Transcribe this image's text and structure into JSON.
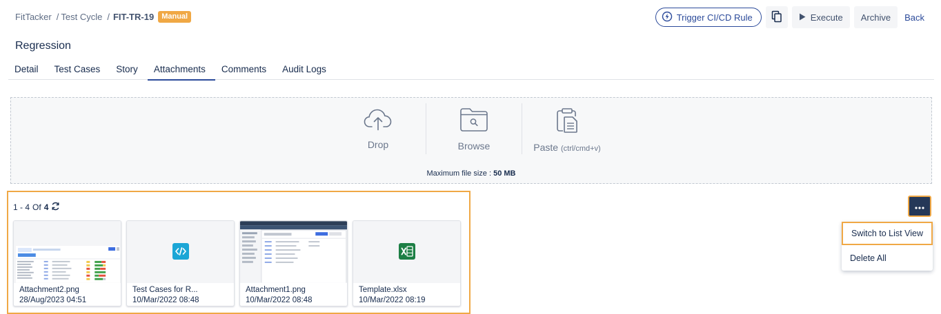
{
  "breadcrumb": {
    "root": "FitTacker",
    "parent": "Test Cycle",
    "sep": "/",
    "current": "FIT-TR-19",
    "badge": "Manual"
  },
  "actions": {
    "trigger": "Trigger CI/CD Rule",
    "execute": "Execute",
    "archive": "Archive",
    "back": "Back"
  },
  "page": {
    "title": "Regression"
  },
  "tabs": [
    "Detail",
    "Test Cases",
    "Story",
    "Attachments",
    "Comments",
    "Audit Logs"
  ],
  "upload": {
    "drop": "Drop",
    "browse": "Browse",
    "paste": "Paste",
    "paste_hint": "(ctrl/cmd+v)",
    "max_label": "Maximum file size :",
    "max_value": "50 MB"
  },
  "pagination": {
    "range": "1 - 4",
    "of": "Of",
    "total": "4"
  },
  "attachments": [
    {
      "name": "Attachment2.png",
      "date": "28/Aug/2023 04:51"
    },
    {
      "name": "Test Cases for R...",
      "date": "10/Mar/2022 08:48"
    },
    {
      "name": "Attachment1.png",
      "date": "10/Mar/2022 08:48"
    },
    {
      "name": "Template.xlsx",
      "date": "10/Mar/2022 08:19"
    }
  ],
  "menu": {
    "switch": "Switch to List View",
    "delete": "Delete All"
  },
  "colors": {
    "accent": "#2b4a9a",
    "badge": "#f0a845",
    "highlight": "#f0a845",
    "dark_button": "#253858",
    "code_icon": "#1ba6d6",
    "excel_icon": "#1d7f45"
  }
}
